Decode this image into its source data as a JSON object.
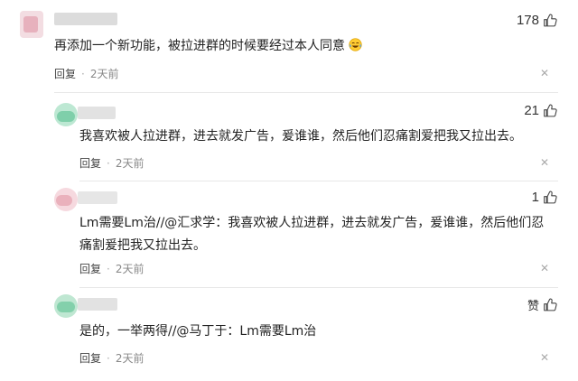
{
  "comments": [
    {
      "likes": "178",
      "text": "再添加一个新功能，被拉进群的时候要经过本人同意",
      "emoji": "crying-laughing-face",
      "reply_label": "回复",
      "dot": "·",
      "time": "2天前",
      "close": "✕"
    },
    {
      "likes": "21",
      "text": "我喜欢被人拉进群，进去就发广告，爰谁谁，然后他们忍痛割爱把我又拉出去。",
      "reply_label": "回复",
      "dot": "·",
      "time": "2天前",
      "close": "✕"
    },
    {
      "likes": "1",
      "text_line1": "Lm需要Lm治//@汇求学：我喜欢被人拉进群，进去就发广告，爰谁谁，然后他们忍",
      "text_line2": "痛割爰把我又拉出去。",
      "reply_label": "回复",
      "dot": "·",
      "time": "2天前",
      "close": "✕"
    },
    {
      "likes": "赞",
      "text": "是的，一举两得//@马丁于：Lm需要Lm治",
      "reply_label": "回复",
      "dot": "·",
      "time": "2天前",
      "close": "✕"
    }
  ],
  "colors": {
    "avatar_pink": "#e9a3b0",
    "avatar_green": "#8fd3b4",
    "blur_gray": "#d8d8d8"
  }
}
